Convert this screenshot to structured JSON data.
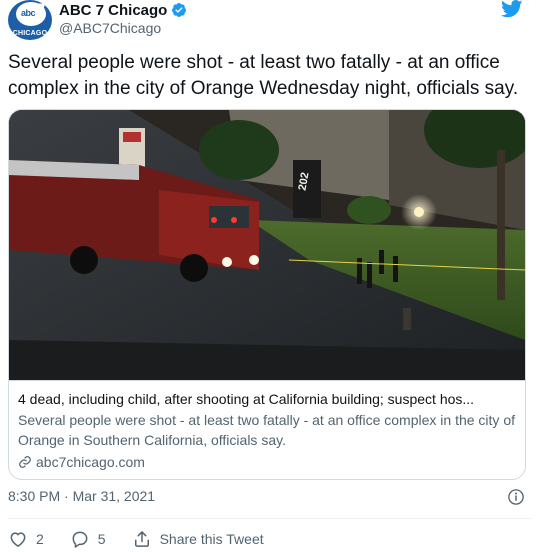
{
  "account": {
    "display_name": "ABC 7 Chicago",
    "handle": "@ABC7Chicago",
    "avatar_icon": "abc7-chicago-logo",
    "avatar_text_top": "abc",
    "avatar_text_number": "7",
    "avatar_text_city": "CHICAGO",
    "verified_icon": "verified-badge-icon"
  },
  "tweet": {
    "text": "Several people were shot - at least two fatally - at an office complex in the city of Orange Wednesday night, officials say.",
    "timestamp": "8:30 PM · Mar 31, 2021"
  },
  "card": {
    "title": "4 dead, including child, after shooting at California building; suspect hos...",
    "description": "Several people were shot - at least two fatally - at an office complex in the city of Orange in Southern California, officials say.",
    "domain": "abc7chicago.com",
    "image_sign_number": "202"
  },
  "actions": {
    "reply_count": "2",
    "like_count": "5",
    "share_label": "Share this Tweet"
  },
  "colors": {
    "brand_blue": "#1d9bf0",
    "text_primary": "#0f1419",
    "text_secondary": "#536471",
    "border": "#cfd9de"
  }
}
